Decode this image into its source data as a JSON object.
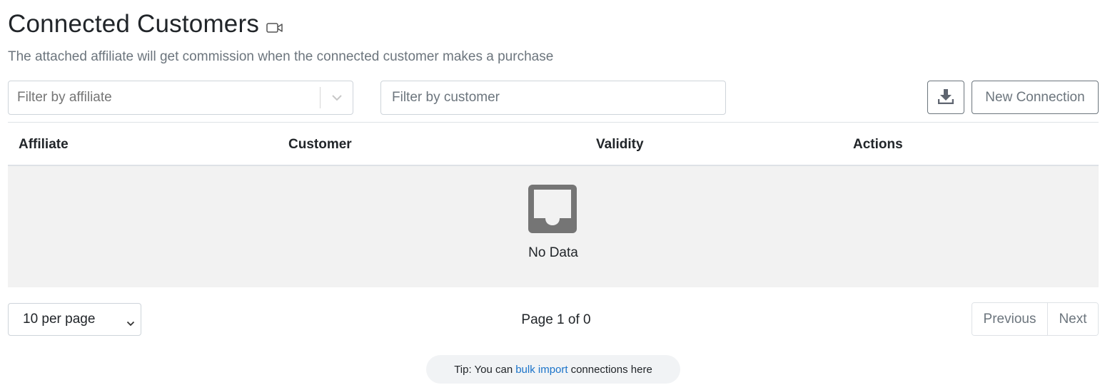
{
  "header": {
    "title": "Connected Customers",
    "video_icon": "video-camera-icon",
    "subtitle": "The attached affiliate will get commission when the connected customer makes a purchase"
  },
  "filters": {
    "affiliate_placeholder": "Filter by affiliate",
    "affiliate_value": "",
    "customer_placeholder": "Filter by customer",
    "customer_value": ""
  },
  "toolbar": {
    "download_icon": "download-icon",
    "new_connection_label": "New Connection"
  },
  "table": {
    "columns": [
      "Affiliate",
      "Customer",
      "Validity",
      "Actions"
    ],
    "rows": [],
    "empty_icon": "inbox-icon",
    "empty_text": "No Data"
  },
  "pagination": {
    "per_page_label": "10 per page",
    "page_info": "Page 1 of 0",
    "previous_label": "Previous",
    "next_label": "Next"
  },
  "tip": {
    "prefix": "Tip: You can",
    "link_text": "bulk import",
    "suffix": "connections here"
  },
  "colors": {
    "muted": "#6c757d",
    "link": "#1a73c9",
    "empty_bg": "#f2f2f2",
    "empty_icon": "#757575"
  }
}
